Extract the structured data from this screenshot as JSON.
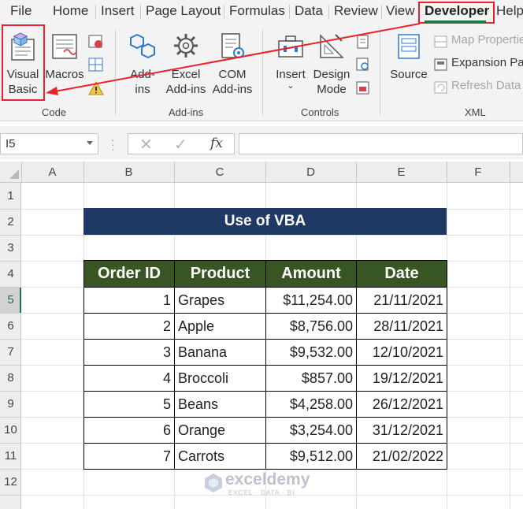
{
  "menu": {
    "tabs": [
      "File",
      "Home",
      "Insert",
      "Page Layout",
      "Formulas",
      "Data",
      "Review",
      "View",
      "Developer",
      "Help"
    ],
    "active_tab": "Developer"
  },
  "ribbon": {
    "code": {
      "visual_basic_line1": "Visual",
      "visual_basic_line2": "Basic",
      "macros": "Macros",
      "group_label": "Code"
    },
    "addins": {
      "addins_line1": "Add-",
      "addins_line2": "ins",
      "excel_addins_line1": "Excel",
      "excel_addins_line2": "Add-ins",
      "com_addins_line1": "COM",
      "com_addins_line2": "Add-ins",
      "group_label": "Add-ins"
    },
    "controls": {
      "insert": "Insert",
      "design_mode_line1": "Design",
      "design_mode_line2": "Mode",
      "group_label": "Controls"
    },
    "xml": {
      "source": "Source",
      "map_properties": "Map Properties",
      "expansion_packs": "Expansion Packs",
      "refresh_data": "Refresh Data",
      "group_label": "XML"
    }
  },
  "formula_bar": {
    "name_box": "I5",
    "fx": "fx",
    "value": ""
  },
  "sheet": {
    "columns": [
      "A",
      "B",
      "C",
      "D",
      "E",
      "F"
    ],
    "rows": [
      "1",
      "2",
      "3",
      "4",
      "5",
      "6",
      "7",
      "8",
      "9",
      "10",
      "11",
      "12"
    ],
    "selected_row": "5"
  },
  "title": "Use of VBA",
  "table": {
    "headers": [
      "Order ID",
      "Product",
      "Amount",
      "Date"
    ],
    "rows": [
      {
        "id": "1",
        "product": "Grapes",
        "amount": "$11,254.00",
        "date": "21/11/2021"
      },
      {
        "id": "2",
        "product": "Apple",
        "amount": "$8,756.00",
        "date": "28/11/2021"
      },
      {
        "id": "3",
        "product": "Banana",
        "amount": "$9,532.00",
        "date": "12/10/2021"
      },
      {
        "id": "4",
        "product": "Broccoli",
        "amount": "$857.00",
        "date": "19/12/2021"
      },
      {
        "id": "5",
        "product": "Beans",
        "amount": "$4,258.00",
        "date": "26/12/2021"
      },
      {
        "id": "6",
        "product": "Orange",
        "amount": "$3,254.00",
        "date": "31/12/2021"
      },
      {
        "id": "7",
        "product": "Carrots",
        "amount": "$9,512.00",
        "date": "21/02/2022"
      }
    ]
  },
  "watermark": {
    "name": "exceldemy",
    "tagline": "EXCEL · DATA · BI"
  },
  "colors": {
    "title_bg": "#203864",
    "header_bg": "#375623",
    "highlight": "#e8212a",
    "excel_green": "#217346"
  }
}
